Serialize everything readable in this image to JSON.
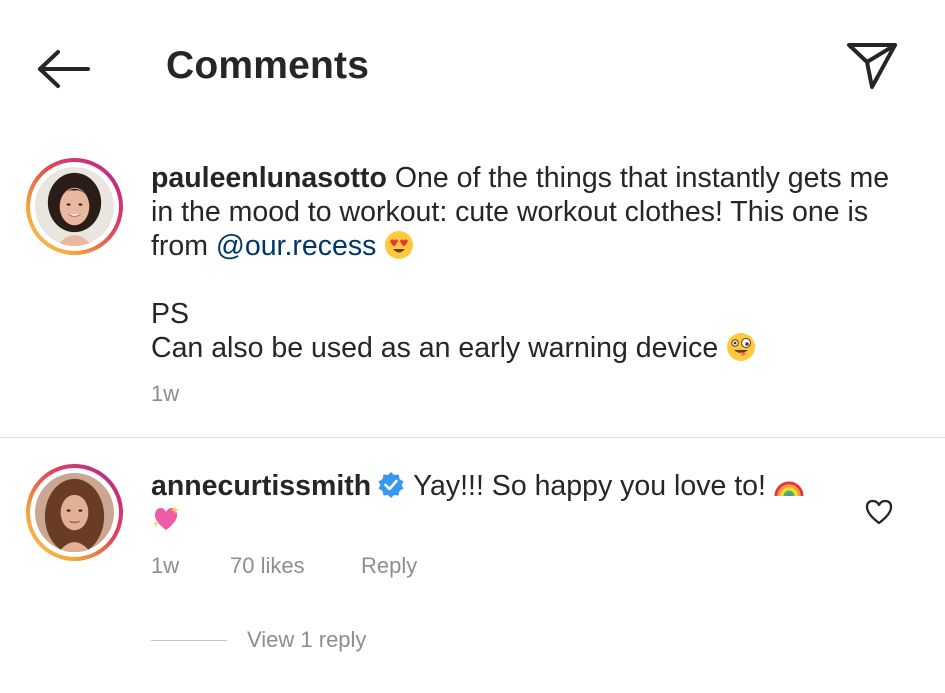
{
  "header": {
    "back_icon": "arrow-left-icon",
    "title": "Comments",
    "share_icon": "paper-plane-icon"
  },
  "caption": {
    "username": "pauleenlunasotto",
    "text_line1": " One of the things that instantly gets me in the mood to workout: cute workout clothes! This one is from ",
    "mention": "@our.recess",
    "emoji1": "heart-eyes-emoji",
    "ps_label": "PS",
    "ps_text": "Can also be used as an early warning device ",
    "emoji2": "zany-face-emoji",
    "time": "1w"
  },
  "comment": {
    "username": "annecurtissmith",
    "verified_icon": "verified-badge-icon",
    "text": "Yay!!! So happy you love to! ",
    "emoji1": "rainbow-emoji",
    "emoji2": "sparkling-heart-emoji",
    "time": "1w",
    "likes": "70 likes",
    "reply_label": "Reply",
    "like_icon": "heart-outline-icon"
  },
  "replies": {
    "view_label": "View 1 reply"
  },
  "colors": {
    "text": "#262626",
    "secondary": "#8e8e8e",
    "mention": "#00376b",
    "verified": "#3897f0",
    "divider": "#dbdbdb"
  }
}
